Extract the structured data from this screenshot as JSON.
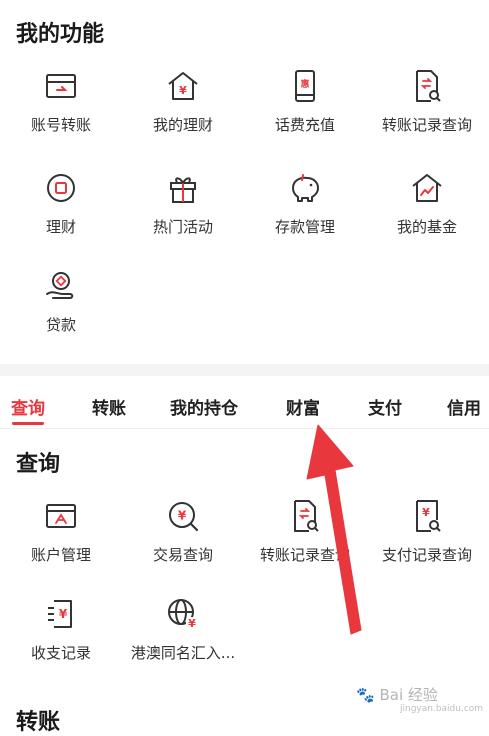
{
  "my_functions": {
    "title": "我的功能",
    "items": [
      {
        "label": "账号转账",
        "icon": "account-transfer-icon"
      },
      {
        "label": "我的理财",
        "icon": "yuan-house-icon"
      },
      {
        "label": "话费充值",
        "icon": "phone-recharge-icon"
      },
      {
        "label": "转账记录查询",
        "icon": "transfer-record-icon"
      },
      {
        "label": "理财",
        "icon": "finance-circle-icon"
      },
      {
        "label": "热门活动",
        "icon": "gift-icon"
      },
      {
        "label": "存款管理",
        "icon": "piggy-bank-icon"
      },
      {
        "label": "我的基金",
        "icon": "fund-house-icon"
      },
      {
        "label": "贷款",
        "icon": "loan-hand-icon"
      }
    ]
  },
  "tabs": [
    {
      "label": "查询",
      "active": true
    },
    {
      "label": "转账",
      "active": false
    },
    {
      "label": "我的持仓",
      "active": false
    },
    {
      "label": "财富",
      "active": false
    },
    {
      "label": "支付",
      "active": false
    },
    {
      "label": "信用",
      "active": false
    }
  ],
  "query": {
    "title": "查询",
    "items": [
      {
        "label": "账户管理",
        "icon": "account-card-icon"
      },
      {
        "label": "交易查询",
        "icon": "yuan-search-icon"
      },
      {
        "label": "转账记录查询",
        "icon": "transfer-record-icon"
      },
      {
        "label": "支付记录查询",
        "icon": "payment-record-icon"
      },
      {
        "label": "收支记录",
        "icon": "income-expense-icon"
      },
      {
        "label": "港澳同名汇入...",
        "icon": "globe-yuan-icon"
      }
    ]
  },
  "transfer": {
    "title": "转账"
  },
  "watermark": {
    "text": "Bai 经验",
    "sub": "jingyan.baidu.com"
  },
  "colors": {
    "accent": "#e8383e",
    "icon_dark": "#333333",
    "arrow": "#e8383e"
  }
}
